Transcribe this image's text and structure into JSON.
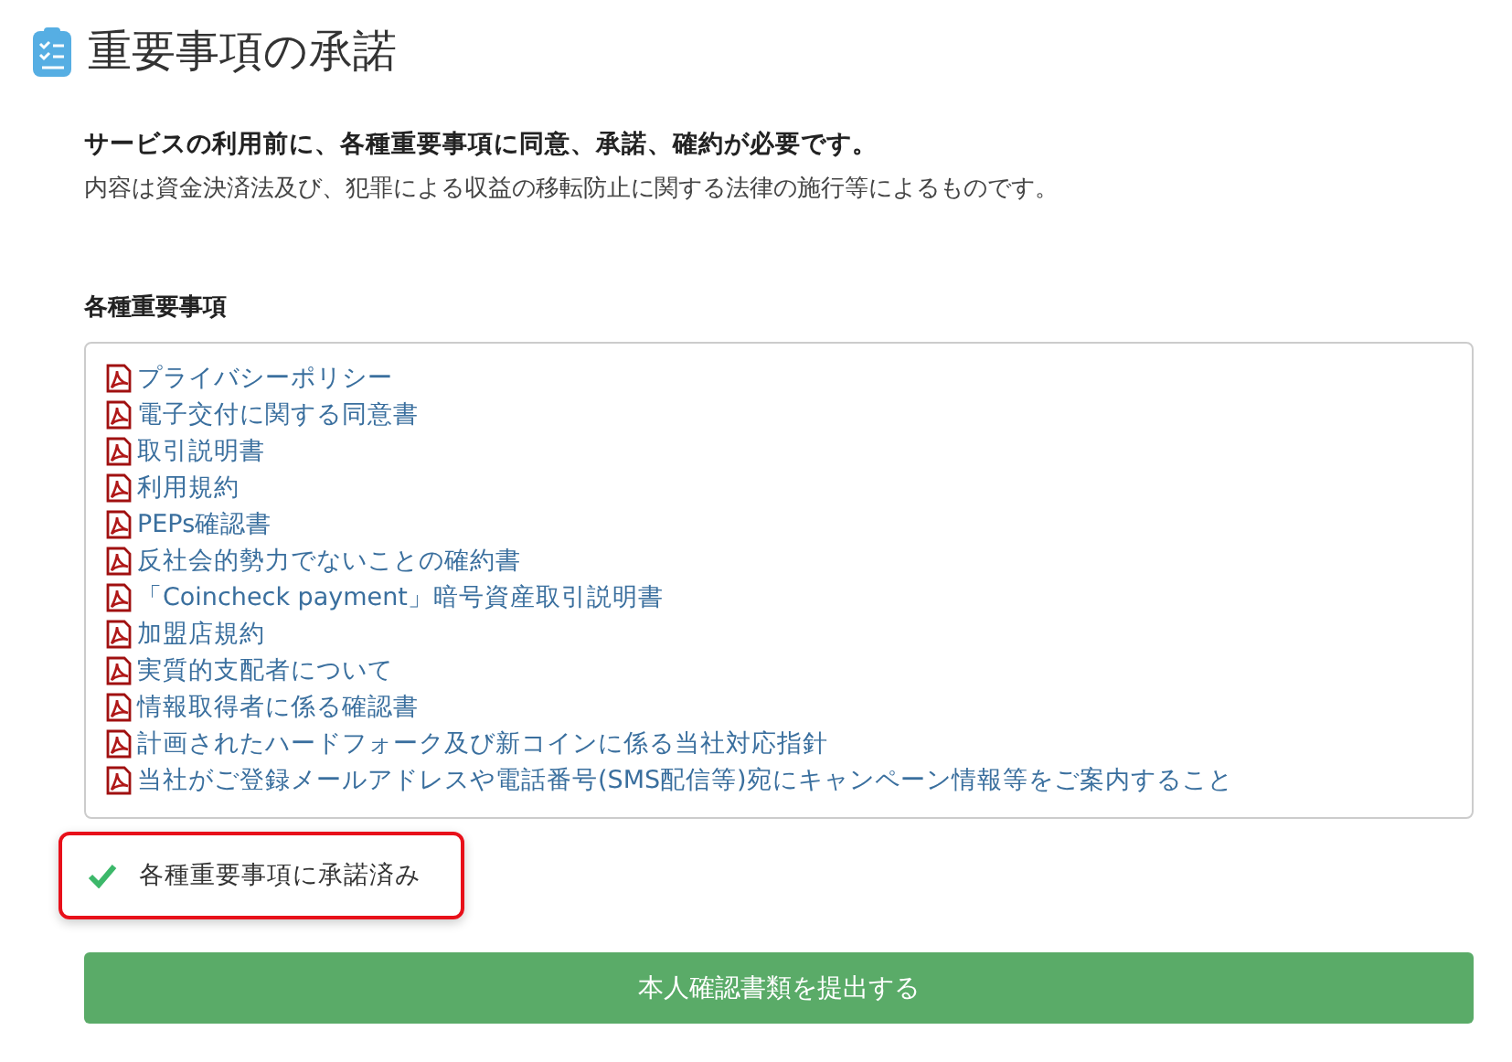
{
  "title": "重要事項の承諾",
  "intro": {
    "lead": "サービスの利用前に、各種重要事項に同意、承諾、確約が必要です。",
    "note": "内容は資金決済法及び、犯罪による収益の移転防止に関する法律の施行等によるものです。"
  },
  "documents": {
    "heading": "各種重要事項",
    "items": [
      {
        "label": "プライバシーポリシー"
      },
      {
        "label": "電子交付に関する同意書"
      },
      {
        "label": "取引説明書"
      },
      {
        "label": "利用規約"
      },
      {
        "label": "PEPs確認書"
      },
      {
        "label": "反社会的勢力でないことの確約書"
      },
      {
        "label": "「Coincheck payment」暗号資産取引説明書"
      },
      {
        "label": "加盟店規約"
      },
      {
        "label": "実質的支配者について"
      },
      {
        "label": "情報取得者に係る確認書"
      },
      {
        "label": "計画されたハードフォーク及び新コインに係る当社対応指針"
      },
      {
        "label": "当社がご登録メールアドレスや電話番号(SMS配信等)宛にキャンペーン情報等をご案内すること"
      }
    ]
  },
  "acceptance": {
    "label": "各種重要事項に承諾済み",
    "checked": true
  },
  "submit_button": "本人確認書類を提出する"
}
